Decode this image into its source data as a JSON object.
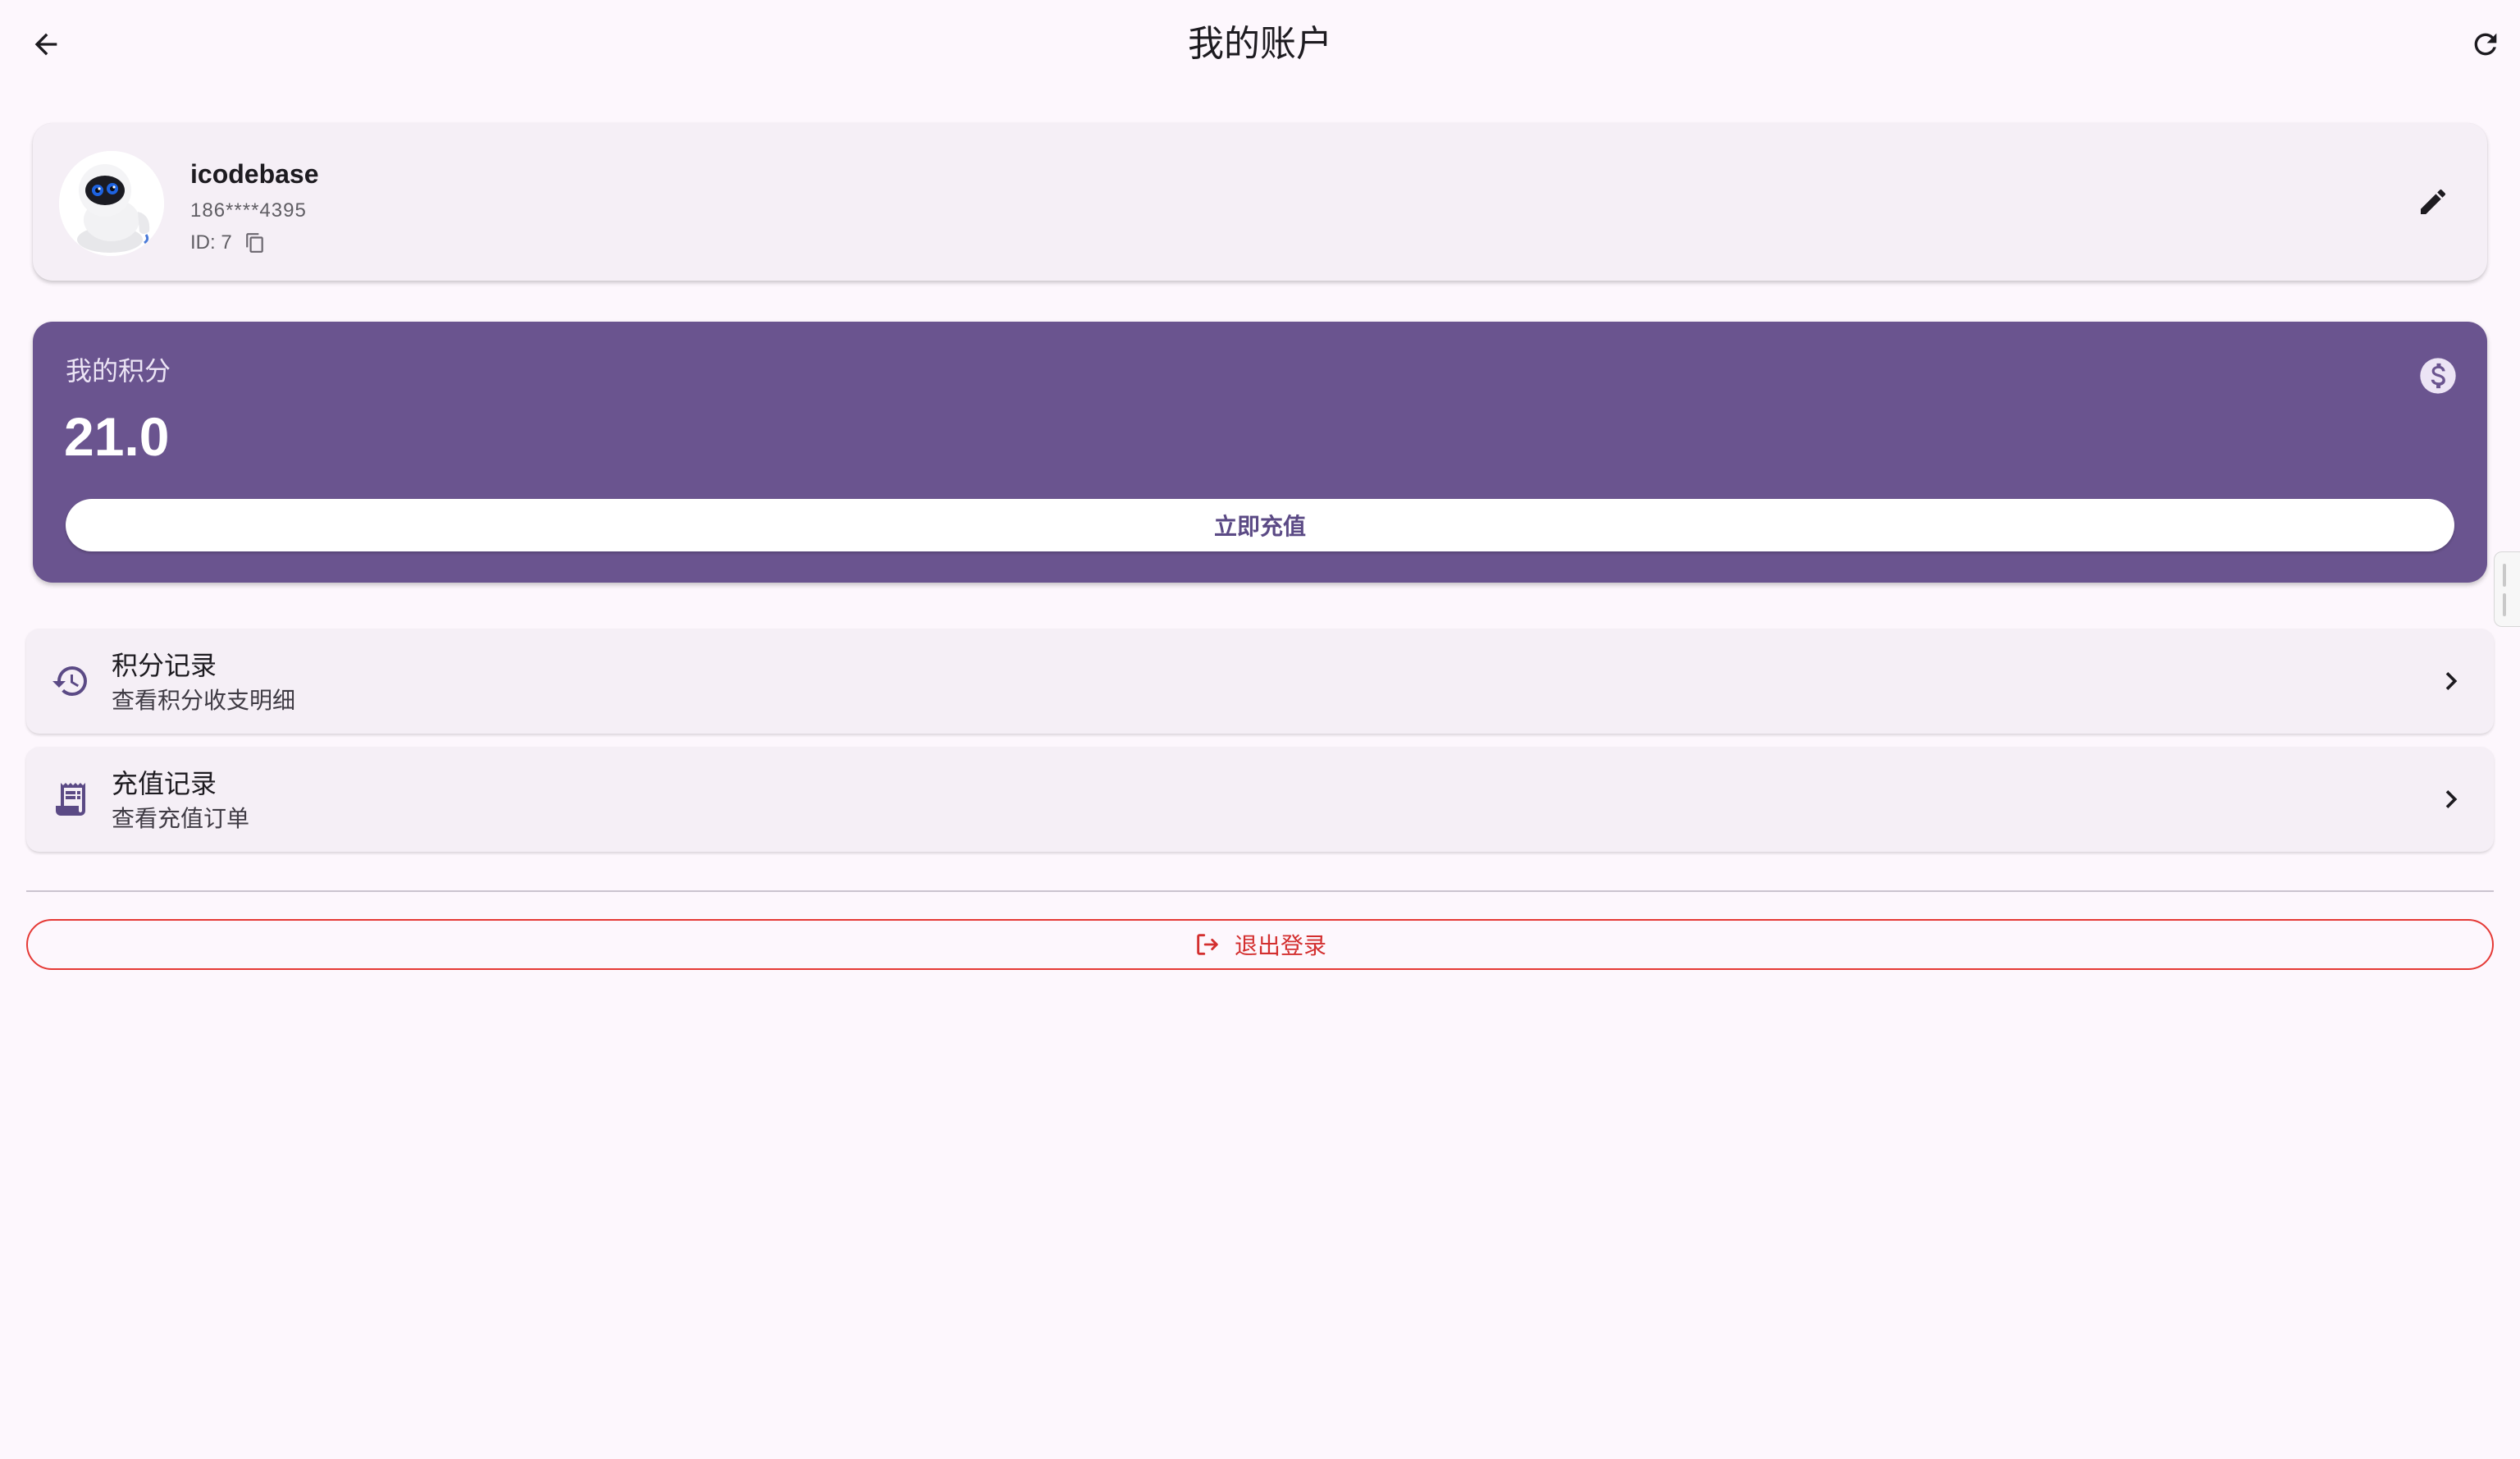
{
  "appbar": {
    "title": "我的账户",
    "back_icon": "arrow-back-icon",
    "refresh_icon": "refresh-icon"
  },
  "profile": {
    "username": "icodebase",
    "phone": "186****4395",
    "id_text": "ID: 7",
    "avatar": "robot-avatar",
    "copy_icon": "copy-icon",
    "edit_icon": "edit-pencil-icon"
  },
  "points": {
    "label": "我的积分",
    "value": "21.0",
    "recharge_label": "立即充值",
    "coin_icon": "dollar-circle-icon",
    "card_color": "#6a548f"
  },
  "menu": {
    "items": [
      {
        "title": "积分记录",
        "subtitle": "查看积分收支明细",
        "icon": "history-icon"
      },
      {
        "title": "充值记录",
        "subtitle": "查看充值订单",
        "icon": "receipt-icon"
      }
    ]
  },
  "logout": {
    "label": "退出登录",
    "icon": "logout-icon",
    "color": "#e53935"
  }
}
